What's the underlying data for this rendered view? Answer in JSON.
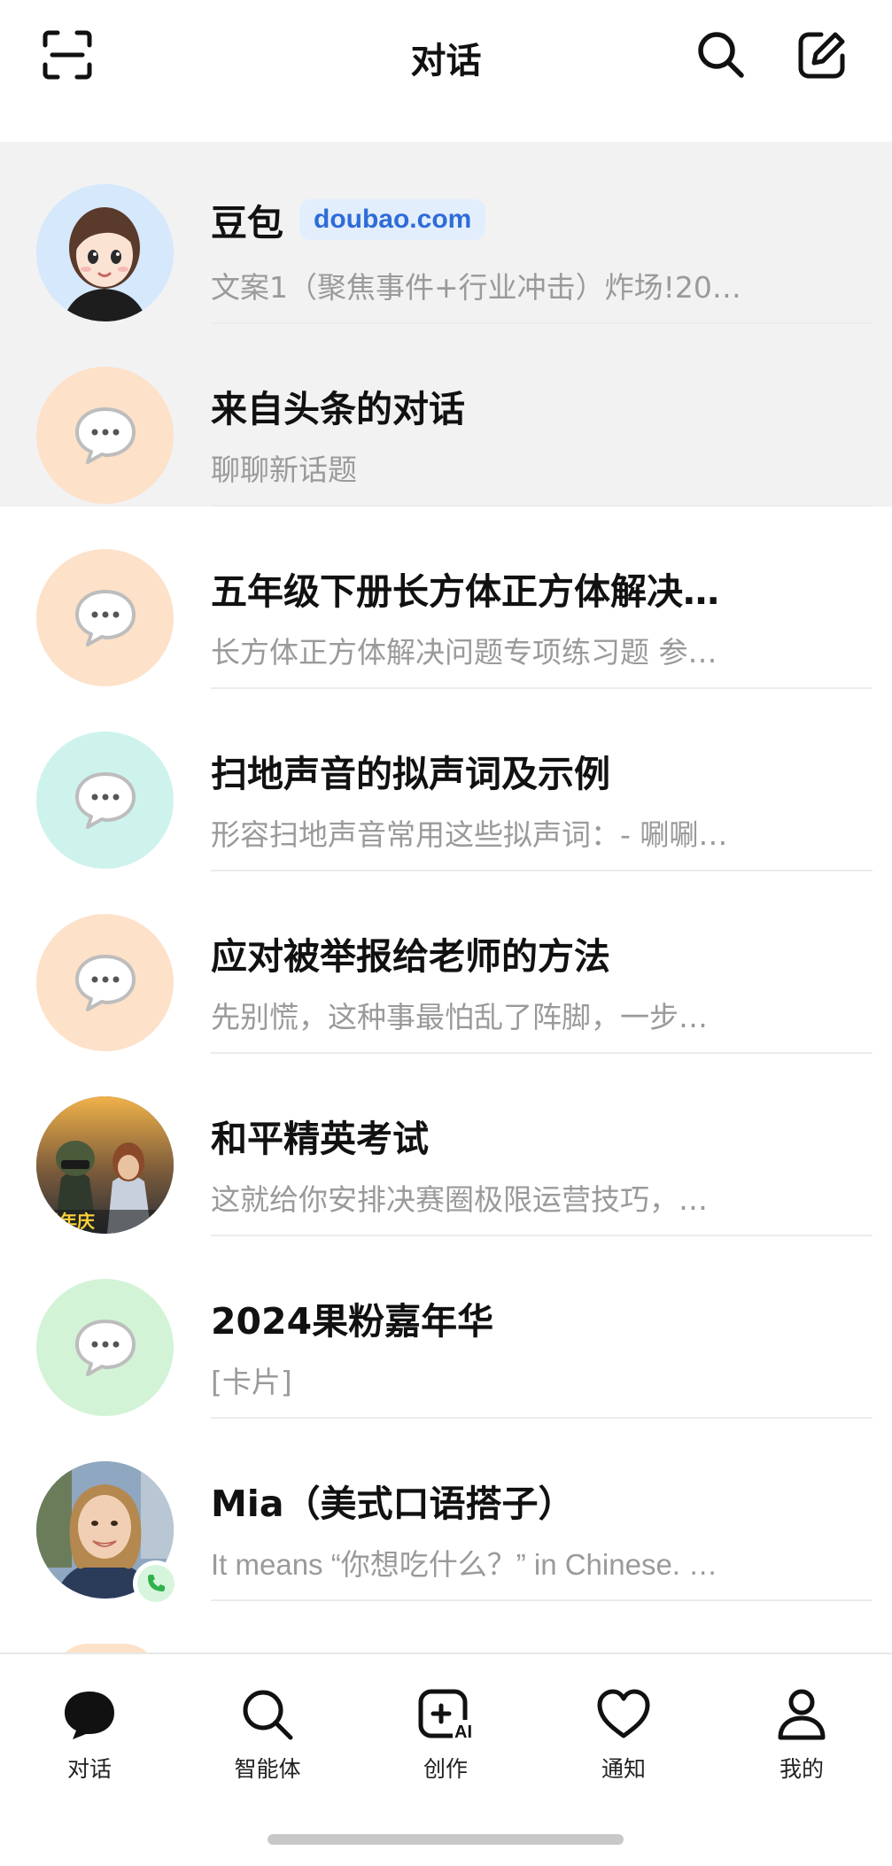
{
  "header": {
    "title": "对话",
    "icons": {
      "left": "scan-icon",
      "search": "search-icon",
      "compose": "compose-icon"
    }
  },
  "conversations": [
    {
      "name": "豆包",
      "tag": "doubao.com",
      "preview": "文案1（聚焦事件+行业冲击）炸场!20…",
      "avatar": "doubao-avatar",
      "avatar_bg": "#d6e8fb",
      "pinned": true
    },
    {
      "name": "来自头条的对话",
      "preview": "聊聊新话题",
      "avatar": "chat-bubble-icon",
      "avatar_bg": "#fde1c8",
      "pinned": true
    },
    {
      "name": "五年级下册长方体正方体解决…",
      "preview": "长方体正方体解决问题专项练习题 参…",
      "avatar": "chat-bubble-icon",
      "avatar_bg": "#fde1c8",
      "pinned": false
    },
    {
      "name": "扫地声音的拟声词及示例",
      "preview": "形容扫地声音常用这些拟声词：- 唰唰…",
      "avatar": "chat-bubble-icon",
      "avatar_bg": "#cdf3ec",
      "pinned": false
    },
    {
      "name": "应对被举报给老师的方法",
      "preview": "先别慌，这种事最怕乱了阵脚，一步…",
      "avatar": "chat-bubble-icon",
      "avatar_bg": "#fde1c8",
      "pinned": false
    },
    {
      "name": "和平精英考试",
      "preview": "这就给你安排决赛圈极限运营技巧，…",
      "avatar": "game-avatar",
      "avatar_bg": "#3b4a5c",
      "pinned": false
    },
    {
      "name": "2024果粉嘉年华",
      "preview": "[卡片]",
      "avatar": "chat-bubble-icon",
      "avatar_bg": "#d3f3d6",
      "pinned": false
    },
    {
      "name": "Mia（美式口语搭子）",
      "preview": "It means “你想吃什么？” in Chinese. …",
      "avatar": "mia-avatar",
      "avatar_bg": "#8fa7c0",
      "pinned": false,
      "badge": "phone-icon"
    }
  ],
  "tabs": [
    {
      "label": "对话",
      "icon": "chat-filled-icon",
      "active": true
    },
    {
      "label": "智能体",
      "icon": "search-icon",
      "active": false
    },
    {
      "label": "创作",
      "icon": "create-ai-icon",
      "active": false
    },
    {
      "label": "通知",
      "icon": "heart-icon",
      "active": false
    },
    {
      "label": "我的",
      "icon": "person-icon",
      "active": false
    }
  ],
  "icon_labels": {
    "create_ai": "AI"
  },
  "colors": {
    "accent_blue": "#2e6cd8",
    "tag_bg": "#e3eefc",
    "pinned_bg": "#f2f2f3",
    "preview_gray": "#9a9a9a",
    "bubble_gray": "#bdbdbd"
  }
}
